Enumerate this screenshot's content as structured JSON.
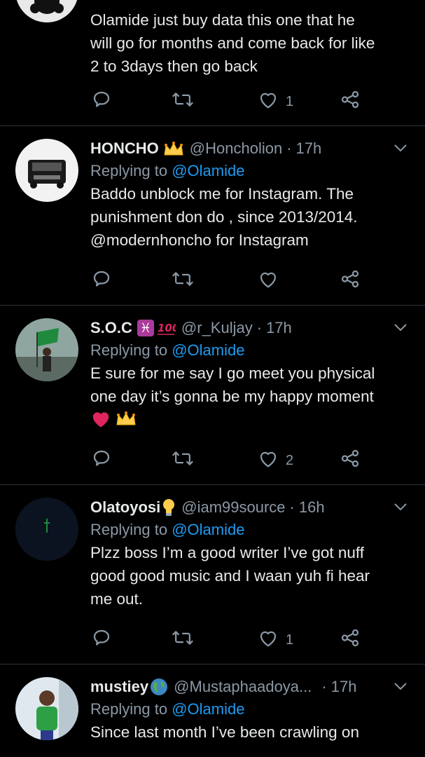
{
  "colors": {
    "background": "#000000",
    "divider": "#2f3336",
    "text_primary": "#e7e9ea",
    "text_secondary": "#8b98a5",
    "accent_link": "#1d9bf0",
    "heart_emoji": "#e0245e",
    "crown_emoji": "#ffcc4d"
  },
  "tweets": [
    {
      "body": "Olamide just buy data this one that he\nwill go for months and come back for like\n2 to 3days then go back",
      "actions": {
        "reply_count": "",
        "retweet_count": "",
        "like_count": "1"
      }
    },
    {
      "name": "HONCHO",
      "name_emoji": "crown-icon",
      "handle": "@Honcholion",
      "separator": "·",
      "time": "17h",
      "reply_prefix": "Replying to ",
      "reply_to": "@Olamide",
      "body": "Baddo unblock me for Instagram. The\npunishment don do , since 2013/2014.\n@modernhoncho for Instagram",
      "actions": {
        "like_count": ""
      }
    },
    {
      "name": "S.O.C",
      "name_emoji": "pisces-and-100-icon",
      "handle": "@r_Kuljay",
      "separator": "·",
      "time": "17h",
      "reply_prefix": "Replying to ",
      "reply_to": "@Olamide",
      "body": "E sure for me say I go meet you physical\none day it’s gonna be my happy moment",
      "trailing_emojis": [
        "heart-icon",
        "crown-icon"
      ],
      "actions": {
        "like_count": "2"
      }
    },
    {
      "name": "Olatoyosi",
      "name_emoji": "lightbulb-icon",
      "handle": "@iam99source",
      "separator": "·",
      "time": "16h",
      "reply_prefix": "Replying to ",
      "reply_to": "@Olamide",
      "body": "Plzz boss I’m a good writer I’ve got nuff\ngood good music and I waan yuh  fi hear\nme out.",
      "actions": {
        "like_count": "1"
      }
    },
    {
      "name": "mustiey",
      "name_emoji": "globe-icon",
      "handle": "@Mustaphaadoya...",
      "separator": "·",
      "time": "17h",
      "reply_prefix": "Replying to ",
      "reply_to": "@Olamide",
      "body": "Since last month I’ve been crawling on"
    }
  ]
}
